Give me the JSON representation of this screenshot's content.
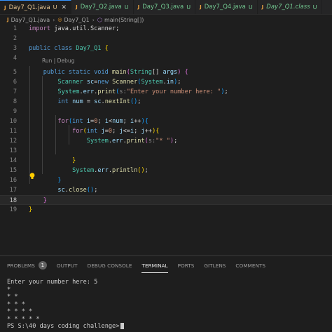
{
  "tabs": [
    {
      "name": "Day7_Q1.java",
      "status": "U",
      "active": true,
      "italic": false,
      "icon": "java-icon",
      "close": "✕"
    },
    {
      "name": "Day7_Q2.java",
      "status": "U",
      "active": false,
      "italic": false,
      "icon": "java-icon"
    },
    {
      "name": "Day7_Q3.java",
      "status": "U",
      "active": false,
      "italic": false,
      "icon": "java-icon"
    },
    {
      "name": "Day7_Q4.java",
      "status": "U",
      "active": false,
      "italic": false,
      "icon": "java-icon"
    },
    {
      "name": "Day7_Q1.class",
      "status": "U",
      "active": false,
      "italic": true,
      "icon": "java-icon"
    }
  ],
  "breadcrumb": {
    "file": "Day7_Q1.java",
    "cls": "Day7_Q1",
    "method": "main(String[])"
  },
  "codelens": "Run | Debug",
  "current_line": 18,
  "lines": [
    {
      "n": "1",
      "segs": [
        [
          "kwc",
          "import "
        ],
        [
          "",
          "java.util.Scanner;"
        ]
      ]
    },
    {
      "n": "2",
      "segs": []
    },
    {
      "n": "3",
      "segs": [
        [
          "kw",
          "public class "
        ],
        [
          "ty",
          "Day7_Q1 "
        ],
        [
          "br1",
          "{"
        ]
      ]
    },
    {
      "n": "4",
      "segs": []
    },
    {
      "n": "5",
      "segs": [
        [
          "",
          "    "
        ],
        [
          "kw",
          "public static void "
        ],
        [
          "fn",
          "main"
        ],
        [
          "br2",
          "("
        ],
        [
          "ty",
          "String"
        ],
        [
          "",
          "[] "
        ],
        [
          "var",
          "args"
        ],
        [
          "br2",
          ")"
        ],
        [
          "",
          " "
        ],
        [
          "br2",
          "{"
        ]
      ]
    },
    {
      "n": "6",
      "segs": [
        [
          "",
          "        "
        ],
        [
          "ty",
          "Scanner "
        ],
        [
          "var",
          "sc"
        ],
        [
          "",
          "="
        ],
        [
          "kw",
          "new "
        ],
        [
          "fn",
          "Scanner"
        ],
        [
          "br3",
          "("
        ],
        [
          "ty",
          "System"
        ],
        [
          "",
          "."
        ],
        [
          "var",
          "in"
        ],
        [
          "br3",
          ")"
        ],
        [
          "",
          ";"
        ]
      ]
    },
    {
      "n": "7",
      "segs": [
        [
          "",
          "        "
        ],
        [
          "ty",
          "System"
        ],
        [
          "",
          "."
        ],
        [
          "var",
          "err"
        ],
        [
          "",
          "."
        ],
        [
          "fn",
          "print"
        ],
        [
          "br3",
          "("
        ],
        [
          "hint",
          "s:"
        ],
        [
          "str",
          "\"Enter your number here: \""
        ],
        [
          "br3",
          ")"
        ],
        [
          "",
          ";"
        ]
      ]
    },
    {
      "n": "8",
      "segs": [
        [
          "",
          "        "
        ],
        [
          "kw",
          "int "
        ],
        [
          "var",
          "num "
        ],
        [
          "",
          "= "
        ],
        [
          "var",
          "sc"
        ],
        [
          "",
          "."
        ],
        [
          "fn",
          "nextInt"
        ],
        [
          "br3",
          "()"
        ],
        [
          "",
          ";"
        ]
      ]
    },
    {
      "n": "9",
      "segs": []
    },
    {
      "n": "10",
      "segs": [
        [
          "",
          "        "
        ],
        [
          "kwc",
          "for"
        ],
        [
          "br3",
          "("
        ],
        [
          "kw",
          "int "
        ],
        [
          "var",
          "i"
        ],
        [
          "",
          "="
        ],
        [
          "str",
          "0"
        ],
        [
          "",
          "; "
        ],
        [
          "var",
          "i"
        ],
        [
          "",
          "<"
        ],
        [
          "var",
          "num"
        ],
        [
          "",
          "; "
        ],
        [
          "var",
          "i"
        ],
        [
          "",
          "++"
        ],
        [
          "br3",
          ")"
        ],
        [
          "br3",
          "{"
        ]
      ]
    },
    {
      "n": "11",
      "segs": [
        [
          "",
          "            "
        ],
        [
          "kwc",
          "for"
        ],
        [
          "br1",
          "("
        ],
        [
          "kw",
          "int "
        ],
        [
          "var",
          "j"
        ],
        [
          "",
          "="
        ],
        [
          "str",
          "0"
        ],
        [
          "",
          "; "
        ],
        [
          "var",
          "j"
        ],
        [
          "",
          "<="
        ],
        [
          "var",
          "i"
        ],
        [
          "",
          "; "
        ],
        [
          "var",
          "j"
        ],
        [
          "",
          "++"
        ],
        [
          "br1",
          ")"
        ],
        [
          "br1",
          "{"
        ]
      ]
    },
    {
      "n": "12",
      "segs": [
        [
          "",
          "                "
        ],
        [
          "ty",
          "System"
        ],
        [
          "",
          "."
        ],
        [
          "var",
          "err"
        ],
        [
          "",
          "."
        ],
        [
          "fn",
          "print"
        ],
        [
          "br2",
          "("
        ],
        [
          "hint",
          "s:"
        ],
        [
          "str",
          "\"* \""
        ],
        [
          "br2",
          ")"
        ],
        [
          "",
          ";"
        ]
      ]
    },
    {
      "n": "13",
      "segs": []
    },
    {
      "n": "14",
      "segs": [
        [
          "",
          "            "
        ],
        [
          "br1",
          "}"
        ]
      ]
    },
    {
      "n": "15",
      "segs": [
        [
          "",
          "            "
        ],
        [
          "ty",
          "System"
        ],
        [
          "",
          "."
        ],
        [
          "var",
          "err"
        ],
        [
          "",
          "."
        ],
        [
          "fn",
          "println"
        ],
        [
          "br1",
          "()"
        ],
        [
          "",
          ";"
        ]
      ]
    },
    {
      "n": "16",
      "segs": [
        [
          "",
          "        "
        ],
        [
          "br3",
          "}"
        ]
      ]
    },
    {
      "n": "17",
      "segs": [
        [
          "",
          "        "
        ],
        [
          "var",
          "sc"
        ],
        [
          "",
          "."
        ],
        [
          "fn",
          "close"
        ],
        [
          "br3",
          "()"
        ],
        [
          "",
          ";"
        ]
      ]
    },
    {
      "n": "18",
      "segs": [
        [
          "",
          "    "
        ],
        [
          "br2",
          "}"
        ]
      ]
    },
    {
      "n": "19",
      "segs": [
        [
          "br1",
          "}"
        ]
      ]
    }
  ],
  "panel": {
    "tabs": [
      {
        "label": "PROBLEMS",
        "badge": "1",
        "active": false
      },
      {
        "label": "OUTPUT",
        "active": false
      },
      {
        "label": "DEBUG CONSOLE",
        "active": false
      },
      {
        "label": "TERMINAL",
        "active": true
      },
      {
        "label": "PORTS",
        "active": false
      },
      {
        "label": "GITLENS",
        "active": false
      },
      {
        "label": "COMMENTS",
        "active": false
      }
    ],
    "terminal": [
      "Enter your number here: 5",
      "*",
      "* *",
      "* * *",
      "* * * *",
      "* * * * *",
      "PS S:\\40 days coding challenge>"
    ]
  },
  "colors": {
    "accent": "#3794ff",
    "editor_bg": "#1e1e1e",
    "keyword": "#569cd6",
    "type": "#4ec9b0",
    "string": "#ce9178"
  }
}
